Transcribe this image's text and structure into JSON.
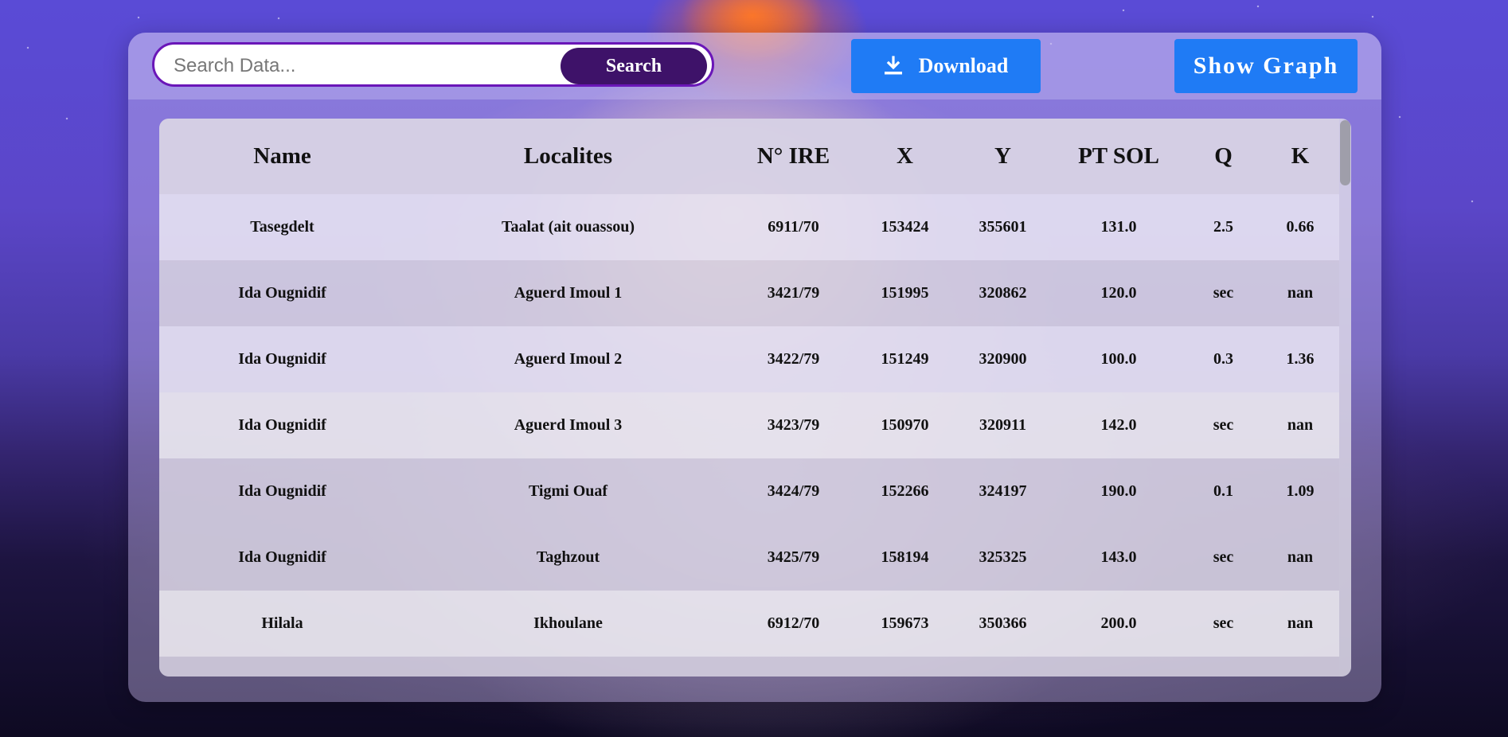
{
  "toolbar": {
    "search": {
      "placeholder": "Search Data...",
      "value": "",
      "button_label": "Search"
    },
    "download_label": "Download",
    "download_icon": "download-icon",
    "show_graph_label": "Show Graph"
  },
  "table": {
    "columns": [
      "Name",
      "Localites",
      "N° IRE",
      "X",
      "Y",
      "PT SOL",
      "Q",
      "K"
    ],
    "rows": [
      [
        "Tasegdelt",
        "Taalat (ait ouassou)",
        "6911/70",
        "153424",
        "355601",
        "131.0",
        "2.5",
        "0.66"
      ],
      [
        "Ida Ougnidif",
        "Aguerd Imoul 1",
        "3421/79",
        "151995",
        "320862",
        "120.0",
        "sec",
        "nan"
      ],
      [
        "Ida Ougnidif",
        "Aguerd Imoul 2",
        "3422/79",
        "151249",
        "320900",
        "100.0",
        "0.3",
        "1.36"
      ],
      [
        "Ida Ougnidif",
        "Aguerd Imoul 3",
        "3423/79",
        "150970",
        "320911",
        "142.0",
        "sec",
        "nan"
      ],
      [
        "Ida Ougnidif",
        "Tigmi Ouaf",
        "3424/79",
        "152266",
        "324197",
        "190.0",
        "0.1",
        "1.09"
      ],
      [
        "Ida Ougnidif",
        "Taghzout",
        "3425/79",
        "158194",
        "325325",
        "143.0",
        "sec",
        "nan"
      ],
      [
        "Hilala",
        "Ikhoulane",
        "6912/70",
        "159673",
        "350366",
        "200.0",
        "sec",
        "nan"
      ]
    ]
  },
  "colors": {
    "accent_blue": "#1f7bf5",
    "search_button": "#3e1269",
    "search_border": "#6a16b8"
  }
}
